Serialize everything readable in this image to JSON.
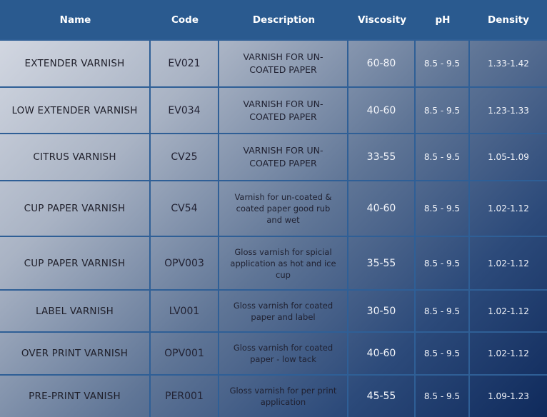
{
  "headers": {
    "name": "Name",
    "code": "Code",
    "description": "Description",
    "viscosity": "Viscosity",
    "ph": "pH",
    "density": "Density"
  },
  "rows": [
    {
      "name": "EXTENDER VARNISH",
      "code": "EV021",
      "description": "VARNISH FOR UN-COATED PAPER",
      "viscosity": "60-80",
      "ph": "8.5 - 9.5",
      "density": "1.33-1.42"
    },
    {
      "name": "LOW EXTENDER VARNISH",
      "code": "EV034",
      "description": "VARNISH FOR UN-COATED PAPER",
      "viscosity": "40-60",
      "ph": "8.5 - 9.5",
      "density": "1.23-1.33"
    },
    {
      "name": "CITRUS VARNISH",
      "code": "CV25",
      "description": "VARNISH FOR UN-COATED PAPER",
      "viscosity": "33-55",
      "ph": "8.5 - 9.5",
      "density": "1.05-1.09"
    },
    {
      "name": "CUP PAPER VARNISH",
      "code": "CV54",
      "description": "Varnish for un-coated & coated paper good rub and wet",
      "viscosity": "40-60",
      "ph": "8.5 - 9.5",
      "density": "1.02-1.12"
    },
    {
      "name": "CUP PAPER VARNISH",
      "code": "OPV003",
      "description": "Gloss varnish for spicial application as hot and ice cup",
      "viscosity": "35-55",
      "ph": "8.5 - 9.5",
      "density": "1.02-1.12"
    },
    {
      "name": "LABEL VARNISH",
      "code": "LV001",
      "description": "Gloss varnish for coated paper and label",
      "viscosity": "30-50",
      "ph": "8.5 - 9.5",
      "density": "1.02-1.12"
    },
    {
      "name": "OVER PRINT VARNISH",
      "code": "OPV001",
      "description": "Gloss varnish for coated paper - low tack",
      "viscosity": "40-60",
      "ph": "8.5 - 9.5",
      "density": "1.02-1.12"
    },
    {
      "name": "PRE-PRINT VANISH",
      "code": "PER001",
      "description": "Gloss varnish for per print application",
      "viscosity": "45-55",
      "ph": "8.5 - 9.5",
      "density": "1.09-1.23"
    }
  ]
}
